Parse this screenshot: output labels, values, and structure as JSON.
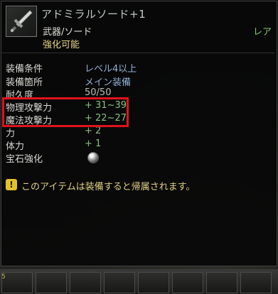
{
  "item": {
    "icon": "sword-icon",
    "name": "アドミラルソード+1",
    "category": "武器/ソード",
    "rarity": "レア",
    "enhance_status": "強化可能"
  },
  "stats": [
    {
      "label": "装備条件",
      "value": "レベル4以上",
      "color": "blue"
    },
    {
      "label": "装備箇所",
      "value": "メイン装備",
      "color": "blue"
    },
    {
      "label": "耐久度",
      "value": "50/50",
      "color": "gray"
    },
    {
      "label": "物理攻撃力",
      "value": "+ 31~39",
      "color": "green"
    },
    {
      "label": "魔法攻撃力",
      "value": "+ 22~27",
      "color": "green"
    },
    {
      "label": "力",
      "value": "+ 2",
      "color": "green"
    },
    {
      "label": "体力",
      "value": "+ 1",
      "color": "green"
    },
    {
      "label": "宝石強化",
      "value": "",
      "color": "gem"
    }
  ],
  "notice": {
    "icon": "warning-icon",
    "symbol": "!",
    "text": "このアイテムは装備すると帰属されます。"
  },
  "hotbar": {
    "slot_label": "5"
  },
  "colors": {
    "highlight": "#e0131b",
    "rarity": "#7ec96e",
    "enhance": "#e7d68a",
    "stat_value": "#84c07a",
    "requirement": "#8fb0d6"
  }
}
